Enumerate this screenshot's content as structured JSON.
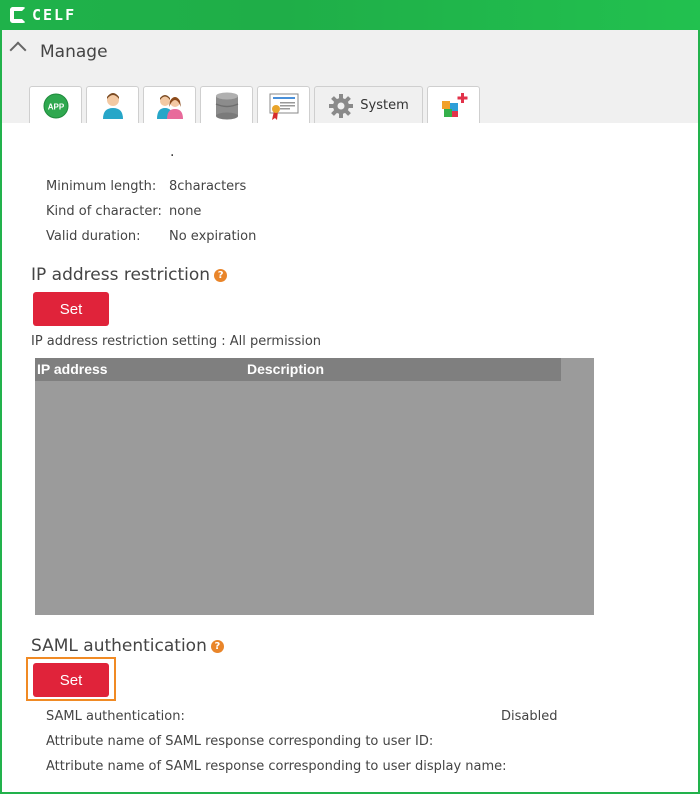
{
  "app": {
    "brand": "CELF"
  },
  "manage": {
    "title": "Manage"
  },
  "tabs": [
    {
      "icon": "app-icon",
      "label": "APP"
    },
    {
      "icon": "user-icon",
      "label": ""
    },
    {
      "icon": "users-icon",
      "label": ""
    },
    {
      "icon": "database-icon",
      "label": ""
    },
    {
      "icon": "certificate-icon",
      "label": ""
    },
    {
      "icon": "gear-icon",
      "label": "System",
      "active": true
    },
    {
      "icon": "blocks-add-icon",
      "label": ""
    }
  ],
  "password_policy": {
    "dot": ".",
    "rows": [
      {
        "key": "Minimum length:",
        "value": "8characters"
      },
      {
        "key": "Kind of character:",
        "value": "none"
      },
      {
        "key": "Valid duration:",
        "value": "No expiration"
      }
    ]
  },
  "ip_restriction": {
    "title": "IP address restriction",
    "help": "?",
    "button": "Set",
    "setting_text": "IP address restriction setting : All permission",
    "columns": [
      "IP address",
      "Description"
    ]
  },
  "saml": {
    "title": "SAML authentication",
    "help": "?",
    "button": "Set",
    "rows": [
      {
        "key": "SAML authentication:",
        "value": "Disabled"
      },
      {
        "key": "Attribute name of SAML response corresponding to user ID:",
        "value": ""
      },
      {
        "key": "Attribute name of SAML response corresponding to user display name:",
        "value": ""
      }
    ]
  },
  "colors": {
    "brand_green": "#22b24c",
    "danger_red": "#e0233a",
    "help_orange": "#e9852a",
    "focus_orange": "#f08a24"
  }
}
